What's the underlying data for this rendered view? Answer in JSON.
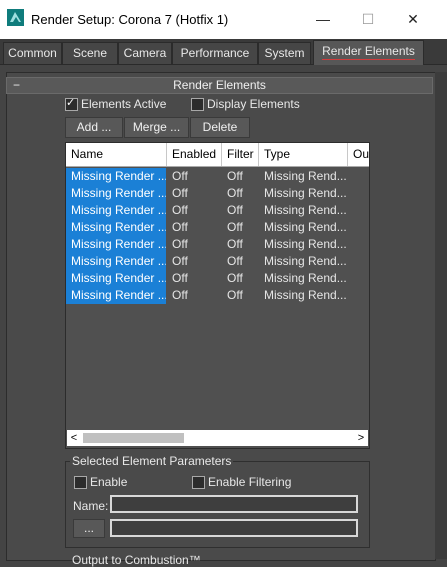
{
  "window": {
    "title": "Render Setup: Corona 7 (Hotfix 1)",
    "minimize": "—",
    "maximize": "☐",
    "close": "✕"
  },
  "tabs": [
    {
      "label": "Common"
    },
    {
      "label": "Scene"
    },
    {
      "label": "Camera"
    },
    {
      "label": "Performance"
    },
    {
      "label": "System"
    },
    {
      "label": "Render Elements",
      "active": true
    }
  ],
  "rollout": {
    "title": "Render Elements",
    "collapse_symbol": "−"
  },
  "options": {
    "elements_active_label": "Elements Active",
    "elements_active_checked": true,
    "display_elements_label": "Display Elements",
    "display_elements_checked": false
  },
  "buttons": {
    "add": "Add ...",
    "merge": "Merge ...",
    "delete": "Delete"
  },
  "list": {
    "columns": [
      "Name",
      "Enabled",
      "Filter",
      "Type",
      "Ou"
    ],
    "rows": [
      {
        "name": "Missing Render ...",
        "enabled": "Off",
        "filter": "Off",
        "type": "Missing Rend..."
      },
      {
        "name": "Missing Render ...",
        "enabled": "Off",
        "filter": "Off",
        "type": "Missing Rend..."
      },
      {
        "name": "Missing Render ...",
        "enabled": "Off",
        "filter": "Off",
        "type": "Missing Rend..."
      },
      {
        "name": "Missing Render ...",
        "enabled": "Off",
        "filter": "Off",
        "type": "Missing Rend..."
      },
      {
        "name": "Missing Render ...",
        "enabled": "Off",
        "filter": "Off",
        "type": "Missing Rend..."
      },
      {
        "name": "Missing Render ...",
        "enabled": "Off",
        "filter": "Off",
        "type": "Missing Rend..."
      },
      {
        "name": "Missing Render ...",
        "enabled": "Off",
        "filter": "Off",
        "type": "Missing Rend..."
      },
      {
        "name": "Missing Render ...",
        "enabled": "Off",
        "filter": "Off",
        "type": "Missing Rend..."
      }
    ],
    "scroll_left": "<",
    "scroll_right": ">"
  },
  "selected_params": {
    "title": "Selected Element Parameters",
    "enable_label": "Enable",
    "enable_filtering_label": "Enable Filtering",
    "name_label": "Name:",
    "name_value": "",
    "browse_button": "...",
    "path_value": ""
  },
  "footer": {
    "label": "Output to Combustion™"
  },
  "colors": {
    "accent_tab_underline": "#d23b3b",
    "selection": "#1b80d6",
    "panel_bg": "#4a4a4a"
  }
}
